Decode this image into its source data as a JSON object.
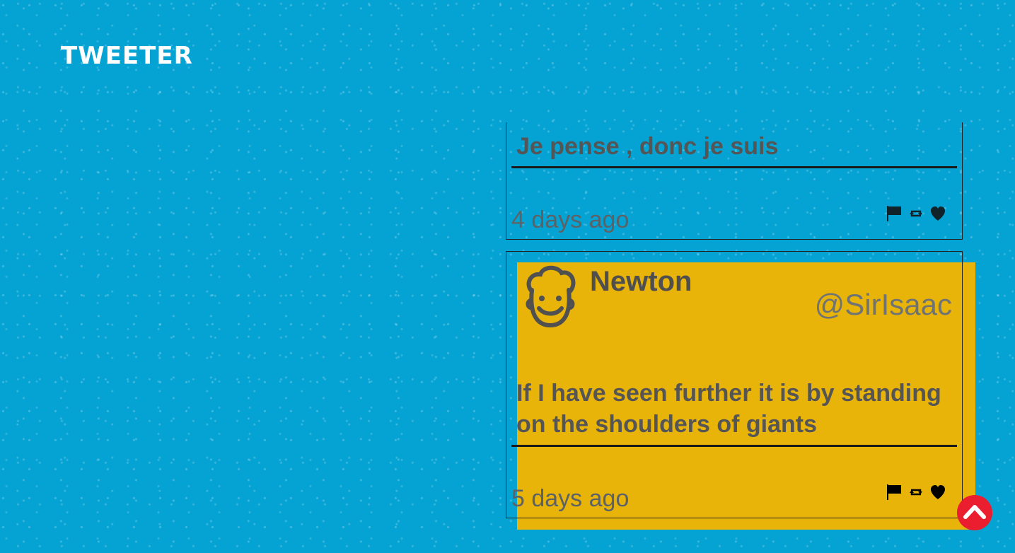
{
  "app": {
    "brand": "TWEETER"
  },
  "tweets": [
    {
      "content": "Je pense , donc je suis",
      "timestamp": "4 days ago"
    },
    {
      "name": "Newton",
      "handle": "@SirIsaac",
      "content": "If I have seen further it is by standing on the shoulders of giants",
      "timestamp": "5 days ago"
    }
  ],
  "icons": {
    "flag": "flag-icon",
    "retweet": "retweet-icon",
    "like": "heart-icon",
    "scroll": "chevron-up-icon"
  },
  "colors": {
    "background": "#05a3d4",
    "accent_shadow": "#e9b40a",
    "scroll_button": "#ea1e2f",
    "text": "#555555"
  }
}
